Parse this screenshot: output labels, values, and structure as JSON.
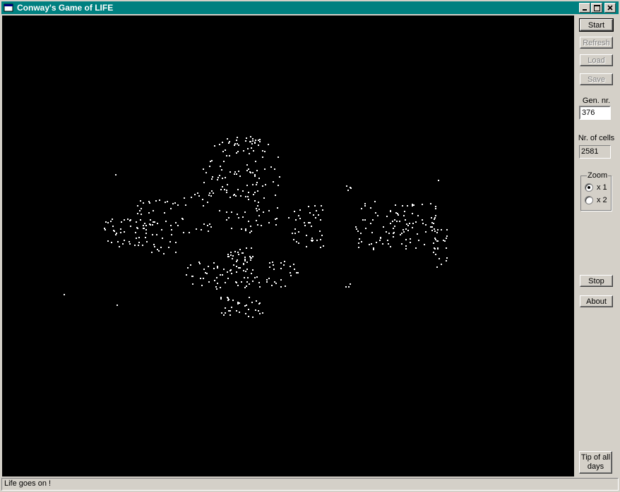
{
  "window": {
    "title": "Conway's Game of LIFE"
  },
  "titlebar_buttons": {
    "minimize": "_",
    "maximize": "□",
    "close": "×"
  },
  "controls": {
    "start": "Start",
    "refresh": "Refresh",
    "load": "Load",
    "save": "Save",
    "gen_label": "Gen. nr.",
    "gen_value": "376",
    "cells_label": "Nr. of cells",
    "cells_value": "2581",
    "zoom_label": "Zoom",
    "zoom_options": [
      {
        "label": "x 1",
        "selected": true
      },
      {
        "label": "x 2",
        "selected": false
      }
    ],
    "stop": "Stop",
    "about": "About",
    "tip": "Tip of all days"
  },
  "status": {
    "text": "Life goes on !"
  },
  "colors": {
    "titlebar": "#008080",
    "canvas": "#000000",
    "cells": "#ffffff"
  }
}
